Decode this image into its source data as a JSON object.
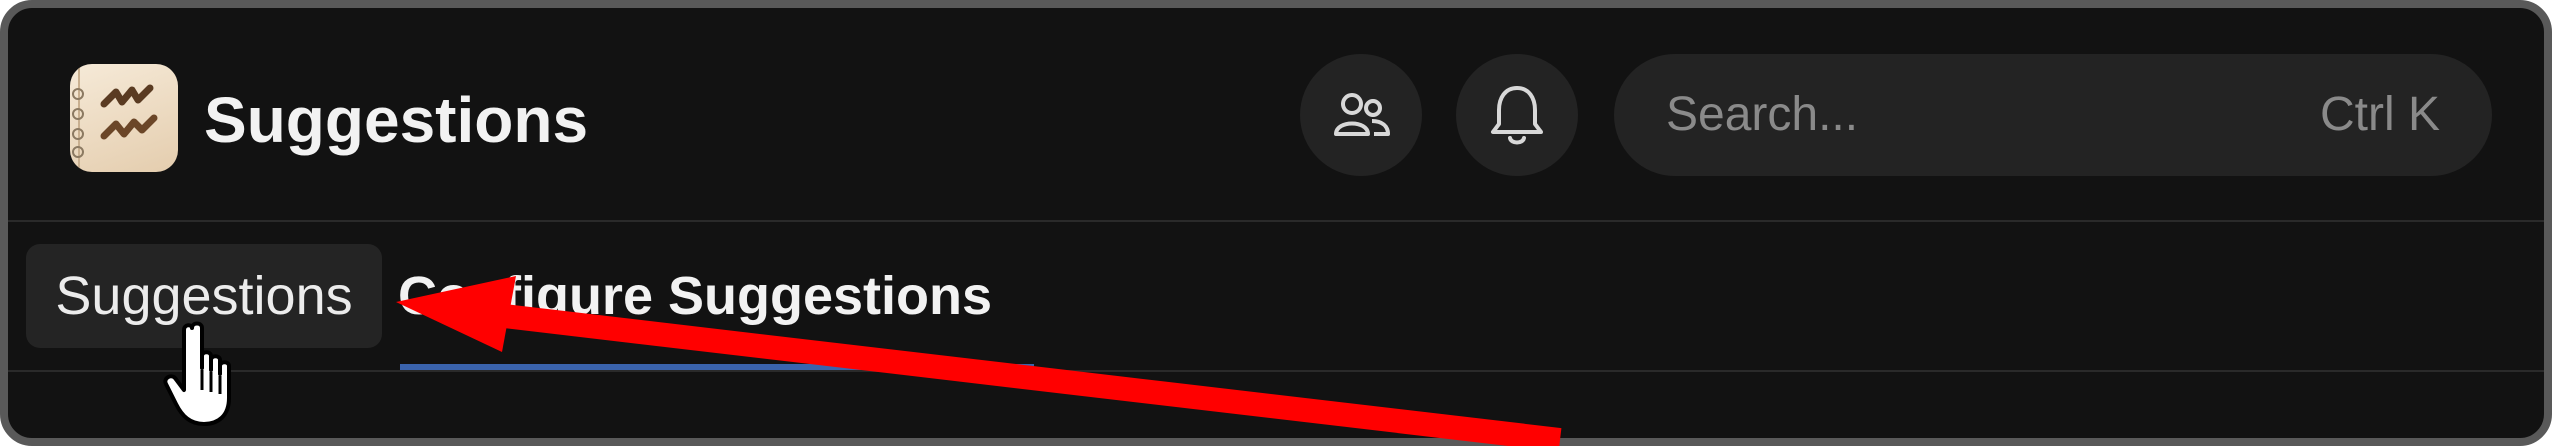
{
  "app": {
    "title": "Suggestions",
    "icon": "notebook-app-icon"
  },
  "header": {
    "people_icon": "people-icon",
    "notification_icon": "bell-icon",
    "search": {
      "placeholder": "Search...",
      "shortcut": "Ctrl K"
    }
  },
  "tabs": [
    {
      "label": "Suggestions",
      "state": "hover"
    },
    {
      "label": "Configure Suggestions",
      "state": "selected"
    }
  ],
  "annotation": {
    "arrow_icon": "red-arrow",
    "arrow_color": "#ff0000",
    "cursor_icon": "hand-pointer-icon"
  },
  "colors": {
    "background": "#121212",
    "frame": "#595959",
    "accent_underline": "#3a63ad",
    "button_fill": "#232323"
  }
}
